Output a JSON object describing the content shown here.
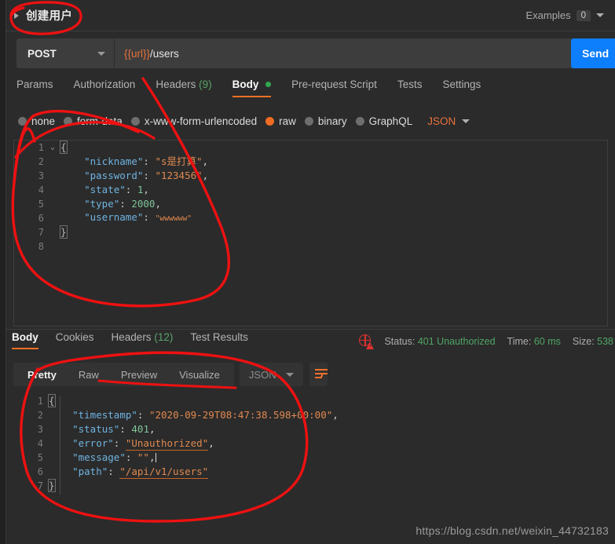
{
  "request": {
    "title": "创建用户",
    "examples_label": "Examples",
    "examples_count": "0",
    "method": "POST",
    "url_variable": "{{url}}",
    "url_path": "/users",
    "send_label": "Send",
    "tabs": [
      {
        "label": "Params",
        "count": "",
        "active": false
      },
      {
        "label": "Authorization",
        "count": "",
        "active": false
      },
      {
        "label": "Headers",
        "count": "(9)",
        "active": false
      },
      {
        "label": "Body",
        "count": "",
        "active": true,
        "dot": true
      },
      {
        "label": "Pre-request Script",
        "count": "",
        "active": false
      },
      {
        "label": "Tests",
        "count": "",
        "active": false
      },
      {
        "label": "Settings",
        "count": "",
        "active": false
      }
    ],
    "body_types": [
      {
        "label": "none",
        "selected": false
      },
      {
        "label": "form-data",
        "selected": false
      },
      {
        "label": "x-www-form-urlencoded",
        "selected": false
      },
      {
        "label": "raw",
        "selected": true
      },
      {
        "label": "binary",
        "selected": false
      },
      {
        "label": "GraphQL",
        "selected": false
      }
    ],
    "format_label": "JSON",
    "body_lines": [
      {
        "num": "1",
        "fold": "⌄",
        "segments": [
          {
            "t": "{",
            "c": "brace"
          }
        ]
      },
      {
        "num": "2",
        "fold": "",
        "segments": [
          {
            "t": "    ",
            "c": "p"
          },
          {
            "t": "\"nickname\"",
            "c": "k"
          },
          {
            "t": ": ",
            "c": "p"
          },
          {
            "t": "\"s是打算\"",
            "c": "s"
          },
          {
            "t": ",",
            "c": "p"
          }
        ]
      },
      {
        "num": "3",
        "fold": "",
        "segments": [
          {
            "t": "    ",
            "c": "p"
          },
          {
            "t": "\"password\"",
            "c": "k"
          },
          {
            "t": ": ",
            "c": "p"
          },
          {
            "t": "\"123456\"",
            "c": "s"
          },
          {
            "t": ",",
            "c": "p"
          }
        ]
      },
      {
        "num": "4",
        "fold": "",
        "segments": [
          {
            "t": "    ",
            "c": "p"
          },
          {
            "t": "\"state\"",
            "c": "k"
          },
          {
            "t": ": ",
            "c": "p"
          },
          {
            "t": "1",
            "c": "n"
          },
          {
            "t": ",",
            "c": "p"
          }
        ]
      },
      {
        "num": "5",
        "fold": "",
        "segments": [
          {
            "t": "    ",
            "c": "p"
          },
          {
            "t": "\"type\"",
            "c": "k"
          },
          {
            "t": ": ",
            "c": "p"
          },
          {
            "t": "2000",
            "c": "n"
          },
          {
            "t": ",",
            "c": "p"
          }
        ]
      },
      {
        "num": "6",
        "fold": "",
        "segments": [
          {
            "t": "    ",
            "c": "p"
          },
          {
            "t": "\"username\"",
            "c": "k"
          },
          {
            "t": ": ",
            "c": "p"
          },
          {
            "t": "\"wwwwww\"",
            "c": "s tiny"
          }
        ]
      },
      {
        "num": "7",
        "fold": "",
        "segments": [
          {
            "t": "}",
            "c": "brace"
          }
        ]
      },
      {
        "num": "8",
        "fold": "",
        "segments": [
          {
            "t": "",
            "c": "p"
          }
        ]
      }
    ]
  },
  "response": {
    "tabs": [
      {
        "label": "Body",
        "count": "",
        "active": true
      },
      {
        "label": "Cookies",
        "count": "",
        "active": false
      },
      {
        "label": "Headers",
        "count": "(12)",
        "active": false
      },
      {
        "label": "Test Results",
        "count": "",
        "active": false
      }
    ],
    "status_label": "Status:",
    "status_value": "401 Unauthorized",
    "time_label": "Time:",
    "time_value": "60 ms",
    "size_label": "Size:",
    "size_value": "538",
    "view_tabs": [
      {
        "label": "Pretty",
        "active": true
      },
      {
        "label": "Raw",
        "active": false
      },
      {
        "label": "Preview",
        "active": false
      },
      {
        "label": "Visualize",
        "active": false
      }
    ],
    "format_label": "JSON",
    "body_lines": [
      {
        "num": "1",
        "segments": [
          {
            "t": "{",
            "c": "brace"
          }
        ]
      },
      {
        "num": "2",
        "segments": [
          {
            "t": "    ",
            "c": "p"
          },
          {
            "t": "\"timestamp\"",
            "c": "k"
          },
          {
            "t": ": ",
            "c": "p"
          },
          {
            "t": "\"2020-09-29T08:47:38.598+00:00\"",
            "c": "s"
          },
          {
            "t": ",",
            "c": "p"
          }
        ]
      },
      {
        "num": "3",
        "segments": [
          {
            "t": "    ",
            "c": "p"
          },
          {
            "t": "\"status\"",
            "c": "k"
          },
          {
            "t": ": ",
            "c": "p"
          },
          {
            "t": "401",
            "c": "n"
          },
          {
            "t": ",",
            "c": "p"
          }
        ]
      },
      {
        "num": "4",
        "segments": [
          {
            "t": "    ",
            "c": "p"
          },
          {
            "t": "\"error\"",
            "c": "k"
          },
          {
            "t": ": ",
            "c": "p"
          },
          {
            "t": "\"Unauthorized\"",
            "c": "s ul-orange"
          },
          {
            "t": ",",
            "c": "p"
          }
        ]
      },
      {
        "num": "5",
        "segments": [
          {
            "t": "    ",
            "c": "p"
          },
          {
            "t": "\"message\"",
            "c": "k"
          },
          {
            "t": ": ",
            "c": "p"
          },
          {
            "t": "\"\"",
            "c": "s"
          },
          {
            "t": ",",
            "c": "p"
          }
        ]
      },
      {
        "num": "6",
        "segments": [
          {
            "t": "    ",
            "c": "p"
          },
          {
            "t": "\"path\"",
            "c": "k"
          },
          {
            "t": ": ",
            "c": "p"
          },
          {
            "t": "\"/api/v1/users\"",
            "c": "s ul-orange"
          }
        ]
      },
      {
        "num": "7",
        "segments": [
          {
            "t": "}",
            "c": "brace"
          }
        ]
      }
    ]
  },
  "watermark": "https://blog.csdn.net/weixin_44732183",
  "colors": {
    "background": "#2b2b2b",
    "accent_orange": "#f47023",
    "send_blue": "#0d7efc",
    "status_green": "#4fa565",
    "annotation_red": "#ee1111"
  }
}
